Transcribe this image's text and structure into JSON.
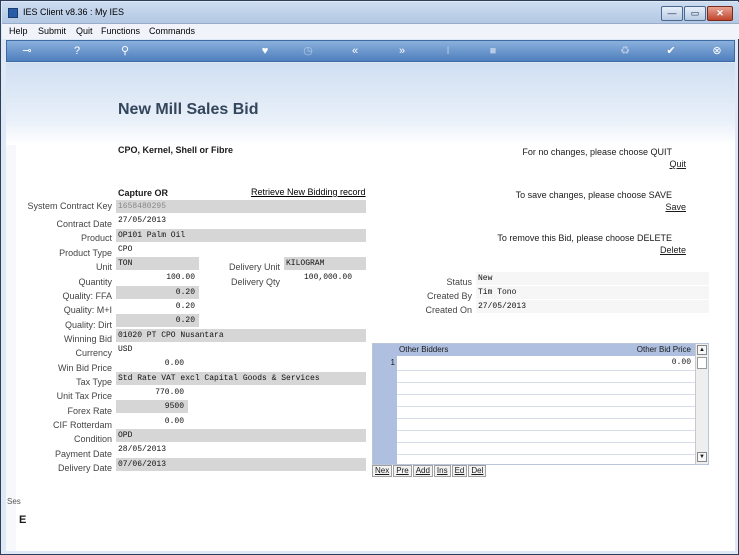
{
  "window": {
    "title": "IES Client v8.36 : My IES",
    "min_glyph": "—",
    "max_glyph": "▭",
    "close_glyph": "✕"
  },
  "menu": [
    "Help",
    "Submit",
    "Quit",
    "Functions",
    "Commands"
  ],
  "toolbar": {
    "icons": {
      "key": "⊸",
      "help": "?",
      "search": "⚲",
      "heart": "♥",
      "clock": "◷",
      "rewind": "«",
      "forward": "»",
      "text": "I",
      "stop": "■",
      "recycle": "♻",
      "check": "✔",
      "close": "⊗"
    }
  },
  "page": {
    "title": "New Mill Sales Bid",
    "subtitle": "CPO, Kernel, Shell or Fibre",
    "capture_label": "Capture OR",
    "retrieve_link": "Retrieve New Bidding record"
  },
  "fields": {
    "system_contract_key": {
      "label": "System Contract Key",
      "value": "1658480295"
    },
    "contract_date": {
      "label": "Contract Date",
      "value": "27/05/2013"
    },
    "product": {
      "label": "Product",
      "value": "OP101 Palm Oil"
    },
    "product_type": {
      "label": "Product Type",
      "value": "CPO"
    },
    "unit": {
      "label": "Unit",
      "value": "TON"
    },
    "delivery_unit": {
      "label": "Delivery Unit",
      "value": "KILOGRAM"
    },
    "quantity": {
      "label": "Quantity",
      "value": "100.00"
    },
    "delivery_qty": {
      "label": "Delivery Qty",
      "value": "100,000.00"
    },
    "quality_ffa": {
      "label": "Quality: FFA",
      "value": "0.20"
    },
    "quality_mi": {
      "label": "Quality: M+I",
      "value": "0.20"
    },
    "quality_dirt": {
      "label": "Quality: Dirt",
      "value": "0.20"
    },
    "winning_bid": {
      "label": "Winning Bid",
      "value": "01020 PT CPO Nusantara"
    },
    "currency": {
      "label": "Currency",
      "value": "USD"
    },
    "win_bid_price": {
      "label": "Win Bid Price",
      "value": "0.00"
    },
    "tax_type": {
      "label": "Tax Type",
      "value": "Std Rate VAT excl Capital Goods & Services"
    },
    "unit_tax_price": {
      "label": "Unit Tax Price",
      "value": "770.00"
    },
    "forex_rate": {
      "label": "Forex Rate",
      "value": "9500"
    },
    "cif_rotterdam": {
      "label": "CIF Rotterdam",
      "value": "0.00"
    },
    "condition": {
      "label": "Condition",
      "value": "OPD"
    },
    "payment_date": {
      "label": "Payment Date",
      "value": "28/05/2013"
    },
    "delivery_date": {
      "label": "Delivery Date",
      "value": "07/06/2013"
    }
  },
  "status": {
    "status": {
      "label": "Status",
      "value": "New"
    },
    "created_by": {
      "label": "Created By",
      "value": "Tim Tono"
    },
    "created_on": {
      "label": "Created On",
      "value": "27/05/2013"
    }
  },
  "actions": {
    "quit_note": "For no changes, please choose QUIT",
    "quit_link": "Quit",
    "save_note": "To save changes, please choose SAVE",
    "save_link": "Save",
    "delete_note": "To remove this Bid,  please choose  DELETE",
    "delete_link": "Delete"
  },
  "bidders_table": {
    "col_bidders": "Other Bidders",
    "col_price": "Other Bid Price",
    "rows": [
      {
        "num": "1",
        "bidder": "",
        "price": "0.00"
      }
    ],
    "scroll_up": "▲",
    "scroll_down": "▼",
    "buttons": [
      "Nex",
      "Pre",
      "Add",
      "Ins",
      "Ed",
      "Del"
    ]
  },
  "session": {
    "label": "Ses",
    "glyph": "E"
  }
}
